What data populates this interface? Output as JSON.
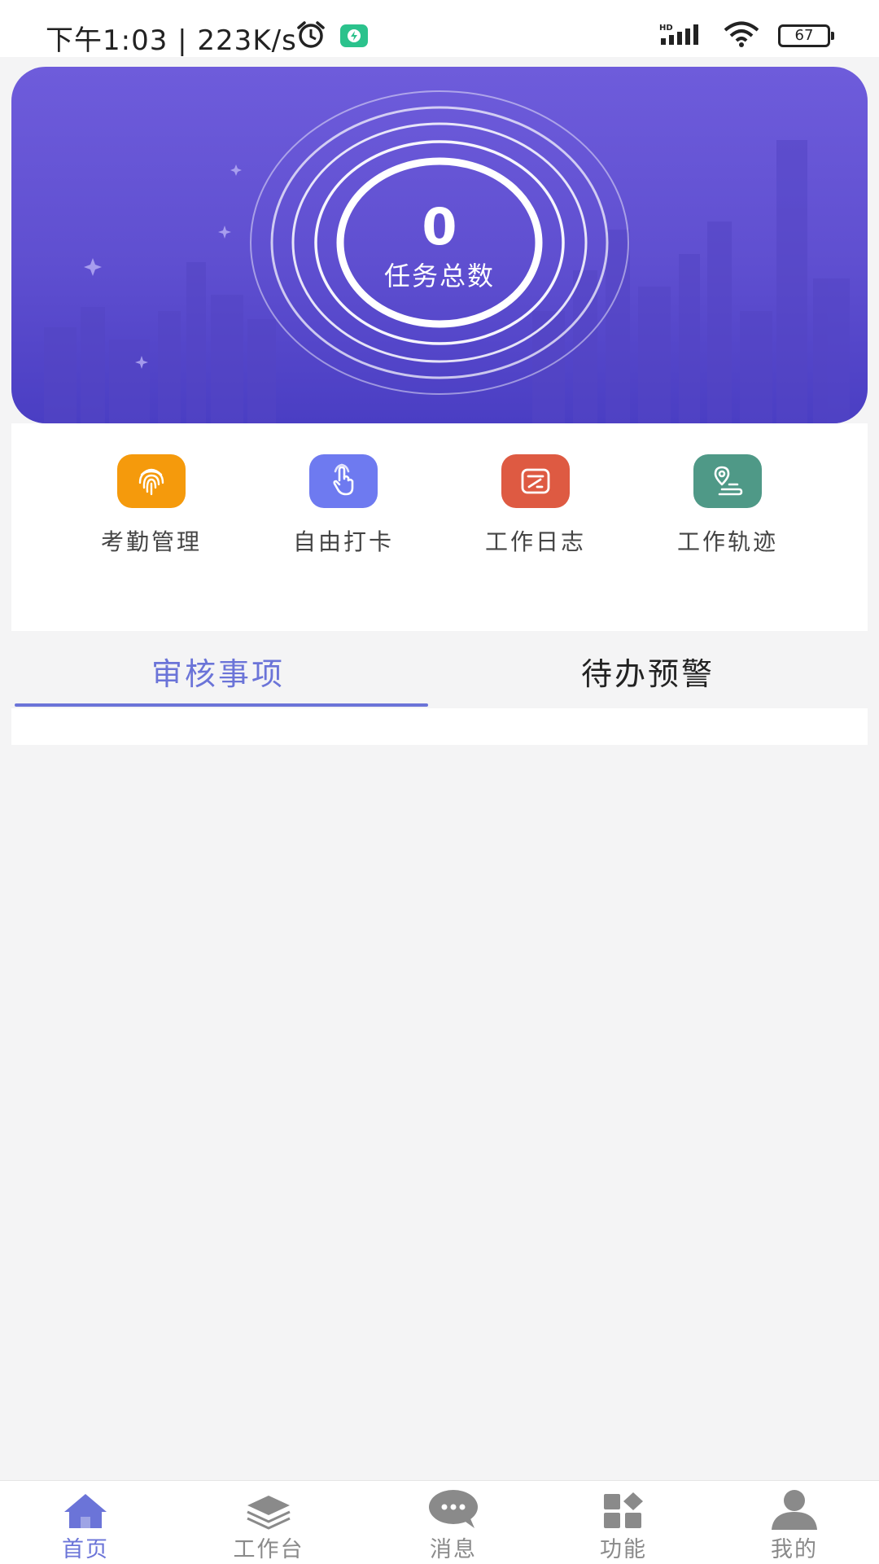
{
  "status_bar": {
    "time": "下午1:03 | 223K/s",
    "battery": "67",
    "network": "HD"
  },
  "banner": {
    "task_count": "0",
    "task_label": "任务总数"
  },
  "quick_menu": [
    {
      "label": "考勤管理",
      "icon": "fingerprint-icon",
      "color": "#f59a0c"
    },
    {
      "label": "自由打卡",
      "icon": "tap-hand-icon",
      "color": "#6e7af0"
    },
    {
      "label": "工作日志",
      "icon": "edit-log-icon",
      "color": "#de5a42"
    },
    {
      "label": "工作轨迹",
      "icon": "location-track-icon",
      "color": "#4f9987"
    }
  ],
  "tabs": [
    {
      "label": "审核事项",
      "active": true
    },
    {
      "label": "待办预警",
      "active": false
    }
  ],
  "bottom_nav": [
    {
      "label": "首页",
      "icon": "home-icon",
      "active": true
    },
    {
      "label": "工作台",
      "icon": "layers-icon",
      "active": false
    },
    {
      "label": "消息",
      "icon": "message-icon",
      "active": false
    },
    {
      "label": "功能",
      "icon": "grid-icon",
      "active": false
    },
    {
      "label": "我的",
      "icon": "user-icon",
      "active": false
    }
  ],
  "colors": {
    "accent": "#6b74d8",
    "banner": "#5f4fd0"
  }
}
